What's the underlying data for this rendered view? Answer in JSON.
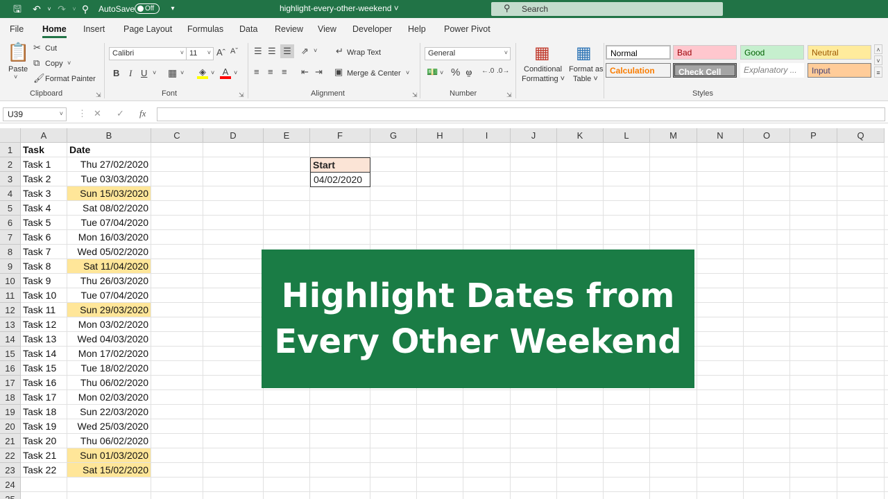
{
  "titlebar": {
    "autosave_label": "AutoSave",
    "autosave_state": "Off",
    "doc_title": "highlight-every-other-weekend ˅",
    "search_placeholder": "Search"
  },
  "tabs": [
    "File",
    "Home",
    "Insert",
    "Page Layout",
    "Formulas",
    "Data",
    "Review",
    "View",
    "Developer",
    "Help",
    "Power Pivot"
  ],
  "active_tab": "Home",
  "ribbon": {
    "clipboard": {
      "paste": "Paste",
      "cut": "Cut",
      "copy": "Copy",
      "format_painter": "Format Painter",
      "label": "Clipboard"
    },
    "font": {
      "name": "Calibri",
      "size": "11",
      "label": "Font",
      "bold": "B",
      "italic": "I",
      "underline": "U",
      "font_color": "A"
    },
    "alignment": {
      "wrap_text": "Wrap Text",
      "merge_center": "Merge & Center",
      "label": "Alignment"
    },
    "number": {
      "format": "General",
      "label": "Number",
      "percent": "%",
      "comma": "9"
    },
    "styles_group": {
      "conditional_formatting": [
        "Conditional",
        "Formatting ˅"
      ],
      "format_as_table": [
        "Format as",
        "Table ˅"
      ],
      "cells": [
        {
          "label": "Normal",
          "bg": "#ffffff",
          "fg": "#000000"
        },
        {
          "label": "Bad",
          "bg": "#ffc7ce",
          "fg": "#9c0006"
        },
        {
          "label": "Good",
          "bg": "#c6efce",
          "fg": "#006100"
        },
        {
          "label": "Neutral",
          "bg": "#ffeb9c",
          "fg": "#9c5700"
        },
        {
          "label": "Calculation",
          "bg": "#f2f2f2",
          "fg": "#fa7d00"
        },
        {
          "label": "Check Cell",
          "bg": "#a5a5a5",
          "fg": "#ffffff"
        },
        {
          "label": "Explanatory ...",
          "bg": "#ffffff",
          "fg": "#7f7f7f"
        },
        {
          "label": "Input",
          "bg": "#ffcc99",
          "fg": "#3f3f76"
        }
      ],
      "label": "Styles"
    }
  },
  "formula_bar": {
    "name_box": "U39",
    "fx": "fx",
    "value": ""
  },
  "columns": [
    "A",
    "B",
    "C",
    "D",
    "E",
    "F",
    "G",
    "H",
    "I",
    "J",
    "K",
    "L",
    "M",
    "N",
    "O",
    "P",
    "Q"
  ],
  "rows": [
    "1",
    "2",
    "3",
    "4",
    "5",
    "6",
    "7",
    "8",
    "9",
    "10",
    "11",
    "12",
    "13",
    "14",
    "15",
    "16",
    "17",
    "18",
    "19",
    "20",
    "21",
    "22",
    "23",
    "24",
    "25"
  ],
  "table": {
    "headers": [
      "Task",
      "Date"
    ],
    "rows": [
      {
        "task": "Task 1",
        "date": "Thu 27/02/2020",
        "highlight": false
      },
      {
        "task": "Task 2",
        "date": "Tue 03/03/2020",
        "highlight": false
      },
      {
        "task": "Task 3",
        "date": "Sun 15/03/2020",
        "highlight": true
      },
      {
        "task": "Task 4",
        "date": "Sat 08/02/2020",
        "highlight": false
      },
      {
        "task": "Task 5",
        "date": "Tue 07/04/2020",
        "highlight": false
      },
      {
        "task": "Task 6",
        "date": "Mon 16/03/2020",
        "highlight": false
      },
      {
        "task": "Task 7",
        "date": "Wed 05/02/2020",
        "highlight": false
      },
      {
        "task": "Task 8",
        "date": "Sat 11/04/2020",
        "highlight": true
      },
      {
        "task": "Task 9",
        "date": "Thu 26/03/2020",
        "highlight": false
      },
      {
        "task": "Task 10",
        "date": "Tue 07/04/2020",
        "highlight": false
      },
      {
        "task": "Task 11",
        "date": "Sun 29/03/2020",
        "highlight": true
      },
      {
        "task": "Task 12",
        "date": "Mon 03/02/2020",
        "highlight": false
      },
      {
        "task": "Task 13",
        "date": "Wed 04/03/2020",
        "highlight": false
      },
      {
        "task": "Task 14",
        "date": "Mon 17/02/2020",
        "highlight": false
      },
      {
        "task": "Task 15",
        "date": "Tue 18/02/2020",
        "highlight": false
      },
      {
        "task": "Task 16",
        "date": "Thu 06/02/2020",
        "highlight": false
      },
      {
        "task": "Task 17",
        "date": "Mon 02/03/2020",
        "highlight": false
      },
      {
        "task": "Task 18",
        "date": "Sun 22/03/2020",
        "highlight": false
      },
      {
        "task": "Task 19",
        "date": "Wed 25/03/2020",
        "highlight": false
      },
      {
        "task": "Task 20",
        "date": "Thu 06/02/2020",
        "highlight": false
      },
      {
        "task": "Task 21",
        "date": "Sun 01/03/2020",
        "highlight": true
      },
      {
        "task": "Task 22",
        "date": "Sat 15/02/2020",
        "highlight": true
      }
    ]
  },
  "start_box": {
    "header": "Start",
    "value": "04/02/2020"
  },
  "banner": {
    "line1": "Highlight Dates from",
    "line2": "Every Other Weekend"
  },
  "colors": {
    "excel_green": "#217346",
    "highlight": "#ffe699",
    "start_fill": "#fbe4d6",
    "banner_green": "#1a7c45"
  }
}
